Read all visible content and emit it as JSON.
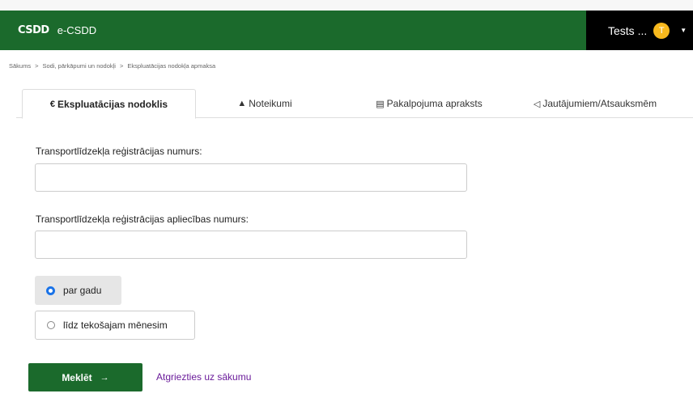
{
  "header": {
    "logo": "CSDD",
    "app_name": "e-CSDD",
    "user_name": "Tests ...",
    "avatar_initial": "T"
  },
  "breadcrumb": {
    "items": [
      "Sākums",
      "Sodi, pārkāpumi un nodokļi",
      "Ekspluatācijas nodokļa apmaksa"
    ],
    "separator": ">"
  },
  "tabs": [
    {
      "icon": "euro-icon",
      "glyph": "€",
      "label": "Ekspluatācijas nodoklis",
      "active": true
    },
    {
      "icon": "warning-icon",
      "glyph": "▲",
      "label": "Noteikumi",
      "active": false
    },
    {
      "icon": "document-icon",
      "glyph": "▤",
      "label": "Pakalpojuma apraksts",
      "active": false
    },
    {
      "icon": "megaphone-icon",
      "glyph": "◁",
      "label": "Jautājumiem/Atsauksmēm",
      "active": false
    }
  ],
  "form": {
    "reg_number_label": "Transportlīdzekļa reģistrācijas numurs:",
    "reg_number_value": "",
    "cert_number_label": "Transportlīdzekļa reģistrācijas apliecības numurs:",
    "cert_number_value": "",
    "period_options": [
      {
        "label": "par gadu",
        "selected": true
      },
      {
        "label": "līdz tekošajam mēnesim",
        "selected": false
      }
    ]
  },
  "actions": {
    "search_label": "Meklēt",
    "search_arrow": "→",
    "back_link": "Atgriezties uz sākumu"
  },
  "colors": {
    "header_green": "#1b6a2c",
    "user_black": "#000000",
    "avatar_yellow": "#f8b91d",
    "link_purple": "#6a1b9a",
    "radio_blue": "#1a73e8"
  }
}
